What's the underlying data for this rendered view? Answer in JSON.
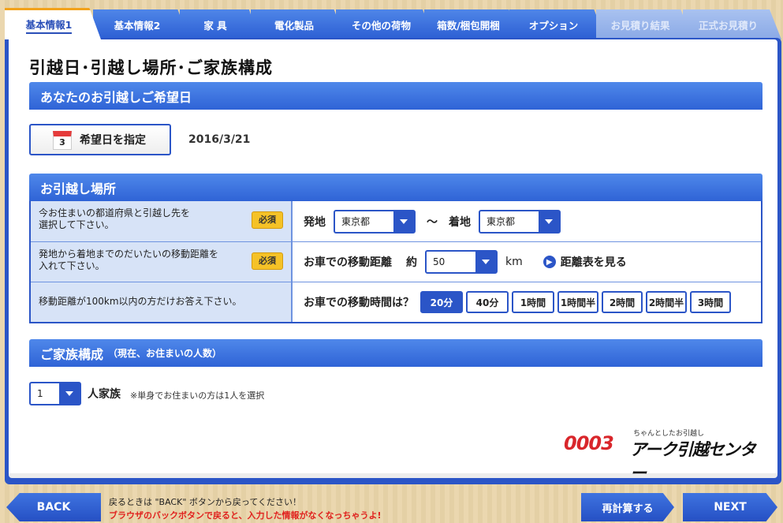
{
  "tabs": [
    {
      "label": "基本情報1",
      "state": "active"
    },
    {
      "label": "基本情報2",
      "state": "normal"
    },
    {
      "label": "家 具",
      "state": "normal"
    },
    {
      "label": "電化製品",
      "state": "normal"
    },
    {
      "label": "その他の荷物",
      "state": "normal"
    },
    {
      "label": "箱数/梱包開梱",
      "state": "normal"
    },
    {
      "label": "オプション",
      "state": "normal"
    },
    {
      "label": "お見積り結果",
      "state": "disabled"
    },
    {
      "label": "正式お見積り",
      "state": "disabled"
    }
  ],
  "page": {
    "title": "引越日･引越し場所･ご家族構成"
  },
  "date_section": {
    "title": "あなたのお引越しご希望日",
    "button_label": "希望日を指定",
    "calendar_number": "3",
    "value": "2016/3/21"
  },
  "location_section": {
    "title": "お引越し場所",
    "required_label": "必須",
    "row1": {
      "question_line1": "今お住まいの都道府県と引越し先を",
      "question_line2": "選択して下さい。",
      "origin_label": "発地",
      "origin_value": "東京都",
      "tilde": "～",
      "dest_label": "着地",
      "dest_value": "東京都"
    },
    "row2": {
      "question_line1": "発地から着地までのだいたいの移動距離を",
      "question_line2": "入れて下さい。",
      "label": "お車での移動距離",
      "approx": "約",
      "value": "50",
      "unit": "km",
      "link": "距離表を見る"
    },
    "row3": {
      "question": "移動距離が100km以内の方だけお答え下さい。",
      "label": "お車での移動時間は？",
      "options": [
        "20分",
        "40分",
        "1時間",
        "1時間半",
        "2時間",
        "2時間半",
        "3時間"
      ],
      "selected_index": 0
    }
  },
  "family_section": {
    "title": "ご家族構成",
    "subtitle": "（現在、お住まいの人数）",
    "value": "1",
    "label": "人家族",
    "note": "※単身でお住まいの方は1人を選択"
  },
  "logo": {
    "number": "0003",
    "tagline": "ちゃんとしたお引越し",
    "name": "アーク引越センター"
  },
  "footer": {
    "back_label": "BACK",
    "recalc_label": "再計算する",
    "next_label": "NEXT",
    "message1": "戻るときは \"BACK\" ボタンから戻ってください！",
    "message2": "ブラウザのバックボタンで戻ると、入力した情報がなくなっちゃうよ!"
  },
  "colors": {
    "primary": "#2b55c7",
    "accent_tab": "#f2a21b",
    "required": "#f5c227",
    "warning_text": "#e0231f"
  }
}
